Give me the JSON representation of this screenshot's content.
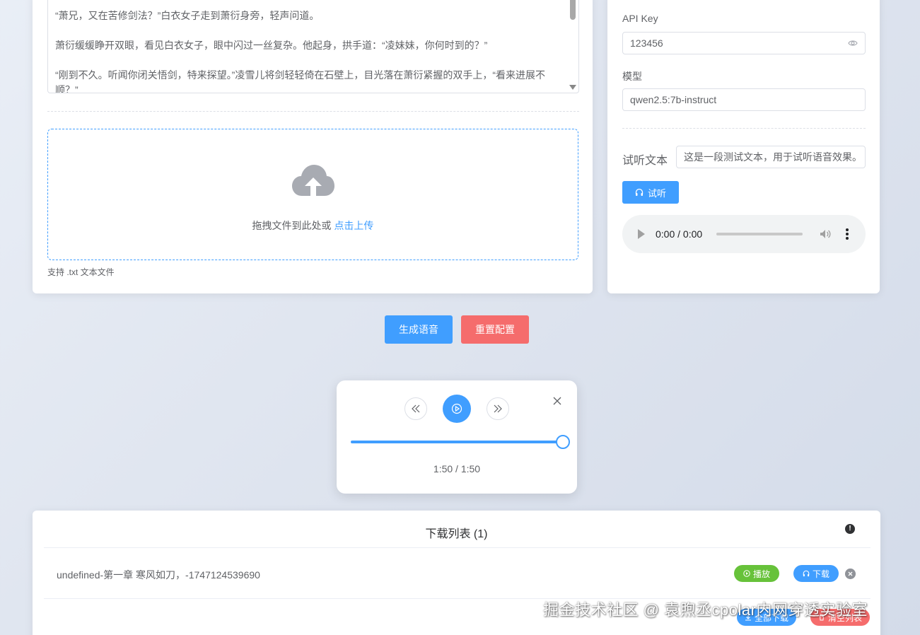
{
  "textarea": {
    "paragraphs": [
      "“萧兄，又在苦修剑法？”白衣女子走到萧衍身旁，轻声问道。",
      "萧衍缓缓睁开双眼，看见白衣女子，眼中闪过一丝复杂。他起身，拱手道：“凌妹妹，你何时到的？”",
      "“刚到不久。听闻你闭关悟剑，特来探望。”凌雪儿将剑轻轻倚在石壁上，目光落在萧衍紧握的双手上，“看来进展不顺？”"
    ]
  },
  "upload": {
    "prompt": "拖拽文件到此处或",
    "link": "点击上传",
    "tip": "支持 .txt 文本文件",
    "icon": "cloud-upload-icon"
  },
  "settings": {
    "api_key_label": "API Key",
    "api_key_value": "123456",
    "model_label": "模型",
    "model_value": "qwen2.5:7b-instruct",
    "preview_label": "试听文本",
    "preview_value": "这是一段测试文本，用于试听语音效果。",
    "listen_button": "试听",
    "audio_time": "0:00 / 0:00"
  },
  "actions": {
    "generate": "生成语音",
    "reset": "重置配置"
  },
  "player": {
    "time": "1:50 / 1:50",
    "progress": 1.0
  },
  "download_list": {
    "title": "下载列表 (1)",
    "items": [
      {
        "name": "undefined-第一章 寒风如刀，-1747124539690",
        "play": "播放",
        "download": "下载"
      }
    ],
    "download_all": "全部下载",
    "clear_list": "清空列表"
  },
  "watermark": "掘金技术社区 @ 袁煦丞cpolar内网穿透实验室",
  "colors": {
    "primary": "#409eff",
    "danger": "#f56c6c",
    "success": "#67c23a"
  }
}
